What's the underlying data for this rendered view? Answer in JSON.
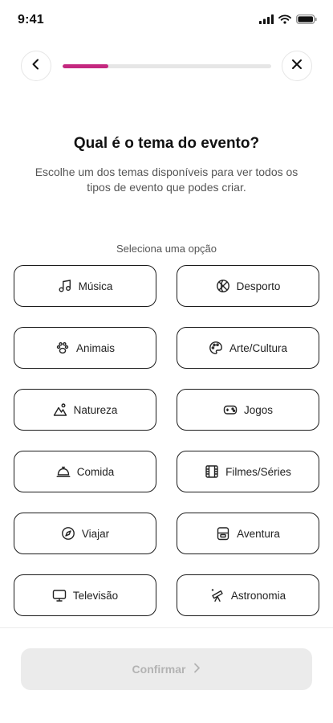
{
  "status_bar": {
    "time": "9:41"
  },
  "progress": {
    "value": 0.22,
    "color": "#c4287f"
  },
  "header": {
    "title": "Qual é o tema do evento?",
    "subtitle": "Escolhe um dos temas disponíveis para ver todos os tipos de evento que podes criar."
  },
  "options_label": "Seleciona uma opção",
  "options": [
    {
      "label": "Música",
      "icon": "music-note-icon"
    },
    {
      "label": "Desporto",
      "icon": "basketball-icon"
    },
    {
      "label": "Animais",
      "icon": "paw-icon"
    },
    {
      "label": "Arte/Cultura",
      "icon": "palette-icon"
    },
    {
      "label": "Natureza",
      "icon": "mountain-icon"
    },
    {
      "label": "Jogos",
      "icon": "gamepad-icon"
    },
    {
      "label": "Comida",
      "icon": "cloche-icon"
    },
    {
      "label": "Filmes/Séries",
      "icon": "film-icon"
    },
    {
      "label": "Viajar",
      "icon": "compass-icon"
    },
    {
      "label": "Aventura",
      "icon": "backpack-icon"
    },
    {
      "label": "Televisão",
      "icon": "tv-icon"
    },
    {
      "label": "Astronomia",
      "icon": "telescope-icon"
    }
  ],
  "footer": {
    "confirm_label": "Confirmar"
  }
}
